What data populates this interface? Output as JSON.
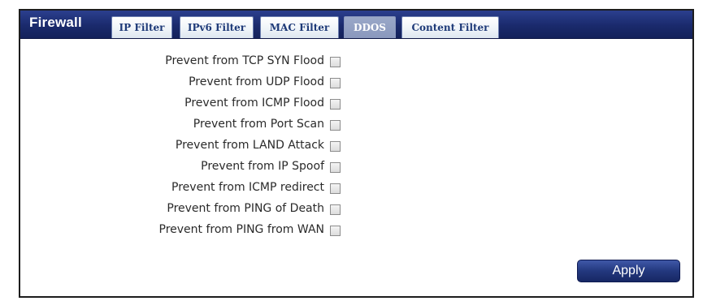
{
  "header": {
    "title": "Firewall"
  },
  "tabs": [
    {
      "label": "IP Filter",
      "active": false
    },
    {
      "label": "IPv6 Filter",
      "active": false
    },
    {
      "label": "MAC Filter",
      "active": false
    },
    {
      "label": "DDOS",
      "active": true
    },
    {
      "label": "Content Filter",
      "active": false
    }
  ],
  "options": [
    {
      "label": "Prevent from TCP SYN Flood",
      "checked": false
    },
    {
      "label": "Prevent from UDP Flood",
      "checked": false
    },
    {
      "label": "Prevent from ICMP Flood",
      "checked": false
    },
    {
      "label": "Prevent from Port Scan",
      "checked": false
    },
    {
      "label": "Prevent from LAND Attack",
      "checked": false
    },
    {
      "label": "Prevent from IP Spoof",
      "checked": false
    },
    {
      "label": "Prevent from ICMP redirect",
      "checked": false
    },
    {
      "label": "Prevent from PING of Death",
      "checked": false
    },
    {
      "label": "Prevent from PING from WAN",
      "checked": false
    }
  ],
  "actions": {
    "apply_label": "Apply"
  },
  "colors": {
    "header_bg": "#1a2a6c",
    "tab_text": "#1e3a78",
    "active_tab_bg": "#8a98bd",
    "button_bg": "#23387e"
  }
}
